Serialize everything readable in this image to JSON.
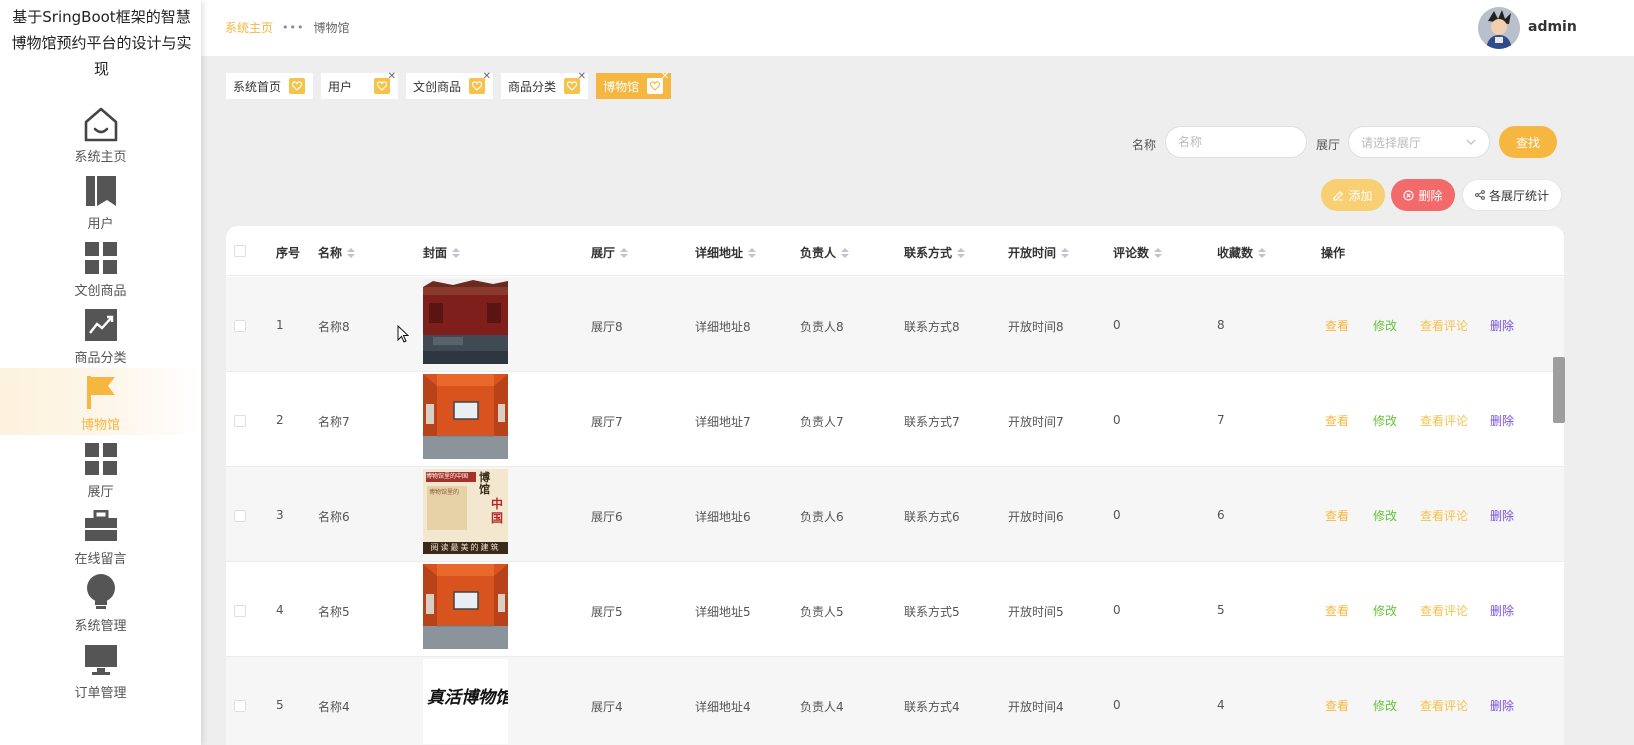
{
  "app": {
    "title": "基于SringBoot框架的智慧博物馆预约平台的设计与实现"
  },
  "sidebar": {
    "items": [
      {
        "label": "系统主页",
        "icon": "home-icon",
        "active": false
      },
      {
        "label": "用户",
        "icon": "book-icon",
        "active": false
      },
      {
        "label": "文创商品",
        "icon": "grid-icon",
        "active": false
      },
      {
        "label": "商品分类",
        "icon": "chart-icon",
        "active": false
      },
      {
        "label": "博物馆",
        "icon": "flag-icon",
        "active": true
      },
      {
        "label": "展厅",
        "icon": "grid-icon",
        "active": false
      },
      {
        "label": "在线留言",
        "icon": "briefcase-icon",
        "active": false
      },
      {
        "label": "系统管理",
        "icon": "bulb-icon",
        "active": false
      },
      {
        "label": "订单管理",
        "icon": "monitor-icon",
        "active": false
      }
    ]
  },
  "header": {
    "breadcrumb": {
      "home": "系统主页",
      "separator": "•••",
      "current": "博物馆"
    },
    "user": {
      "name": "admin"
    }
  },
  "tags": [
    {
      "label": "系统首页",
      "closable": false,
      "active": false
    },
    {
      "label": "用户",
      "closable": true,
      "active": false
    },
    {
      "label": "文创商品",
      "closable": true,
      "active": false
    },
    {
      "label": "商品分类",
      "closable": true,
      "active": false
    },
    {
      "label": "博物馆",
      "closable": true,
      "active": true
    }
  ],
  "search": {
    "name_label": "名称",
    "name_placeholder": "名称",
    "hall_label": "展厅",
    "hall_placeholder": "请选择展厅",
    "search_button": "查找"
  },
  "actions": {
    "add": "添加",
    "delete": "删除",
    "stats": "各展厅统计"
  },
  "table": {
    "columns": {
      "index": "序号",
      "name": "名称",
      "cover": "封面",
      "hall": "展厅",
      "address": "详细地址",
      "manager": "负责人",
      "contact": "联系方式",
      "open_time": "开放时间",
      "comments": "评论数",
      "favorites": "收藏数",
      "operations": "操作"
    },
    "row_actions": {
      "view": "查看",
      "edit": "修改",
      "comments": "查看评论",
      "delete": "删除"
    },
    "rows": [
      {
        "index": "1",
        "name": "名称8",
        "cover": "palace",
        "hall": "展厅8",
        "address": "详细地址8",
        "manager": "负责人8",
        "contact": "联系方式8",
        "open_time": "开放时间8",
        "comments": "0",
        "favorites": "8"
      },
      {
        "index": "2",
        "name": "名称7",
        "cover": "gallery",
        "hall": "展厅7",
        "address": "详细地址7",
        "manager": "负责人7",
        "contact": "联系方式7",
        "open_time": "开放时间7",
        "comments": "0",
        "favorites": "7"
      },
      {
        "index": "3",
        "name": "名称6",
        "cover": "book",
        "hall": "展厅6",
        "address": "详细地址6",
        "manager": "负责人6",
        "contact": "联系方式6",
        "open_time": "开放时间6",
        "comments": "0",
        "favorites": "6"
      },
      {
        "index": "4",
        "name": "名称5",
        "cover": "gallery",
        "hall": "展厅5",
        "address": "详细地址5",
        "manager": "负责人5",
        "contact": "联系方式5",
        "open_time": "开放时间5",
        "comments": "0",
        "favorites": "5"
      },
      {
        "index": "5",
        "name": "名称4",
        "cover": "calligraphy",
        "hall": "展厅4",
        "address": "详细地址4",
        "manager": "负责人4",
        "contact": "联系方式4",
        "open_time": "开放时间4",
        "comments": "0",
        "favorites": "4"
      }
    ]
  },
  "covers": {
    "book": {
      "title_top": "博物馆里的中国",
      "side_text": "博物馆里的",
      "big_char": "中国",
      "caption": "阅读最美的建筑"
    },
    "calligraphy": {
      "text": "真活博物馆"
    }
  },
  "colors": {
    "accent": "#f5b740",
    "edit": "#67c23a",
    "delete_link": "#7b4fe0",
    "delete_button": "#f26a6a"
  }
}
